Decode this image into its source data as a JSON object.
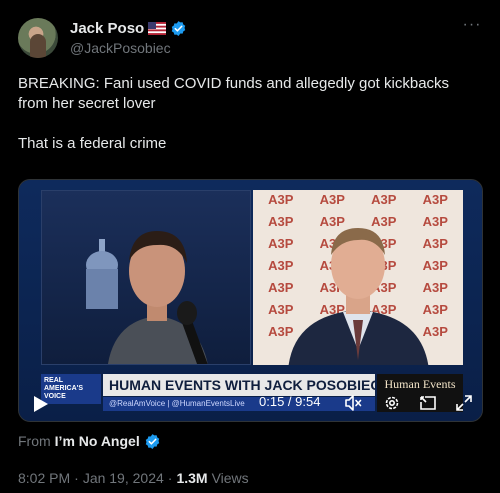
{
  "author": {
    "name": "Jack Poso",
    "handle": "@JackPosobiec",
    "flag_icon": "us-flag-icon",
    "verified_icon": "verified-badge-icon",
    "verified_color": "#1d9bf0"
  },
  "more_label": "···",
  "tweet": {
    "text": "BREAKING: Fani used COVID funds and allegedly got kickbacks from her secret lover\n\nThat is a federal crime"
  },
  "video": {
    "time_display": "0:15 / 9:54",
    "lower_third_title": "HUMAN EVENTS WITH JACK POSOBIEC",
    "lower_third_sub": "@RealAmVoice | @HumanEventsLive",
    "network_logo": "REAL AMERICA'S VOICE",
    "brand": "Human Events",
    "backdrop_text": "A3P",
    "controls": {
      "play_icon": "play-icon",
      "mute_icon": "volume-muted-icon",
      "settings_icon": "gear-icon",
      "pip_icon": "picture-in-picture-icon",
      "fullscreen_icon": "fullscreen-icon"
    }
  },
  "from": {
    "label": "From",
    "source": "I’m No Angel"
  },
  "meta": {
    "time": "8:02 PM",
    "sep": "·",
    "date": "Jan 19, 2024",
    "sep2": "·",
    "views_count": "1.3M",
    "views_label": "Views"
  },
  "colors": {
    "background": "#000000",
    "text": "#e7e9ea",
    "muted": "#71767b",
    "accent": "#1d9bf0"
  }
}
